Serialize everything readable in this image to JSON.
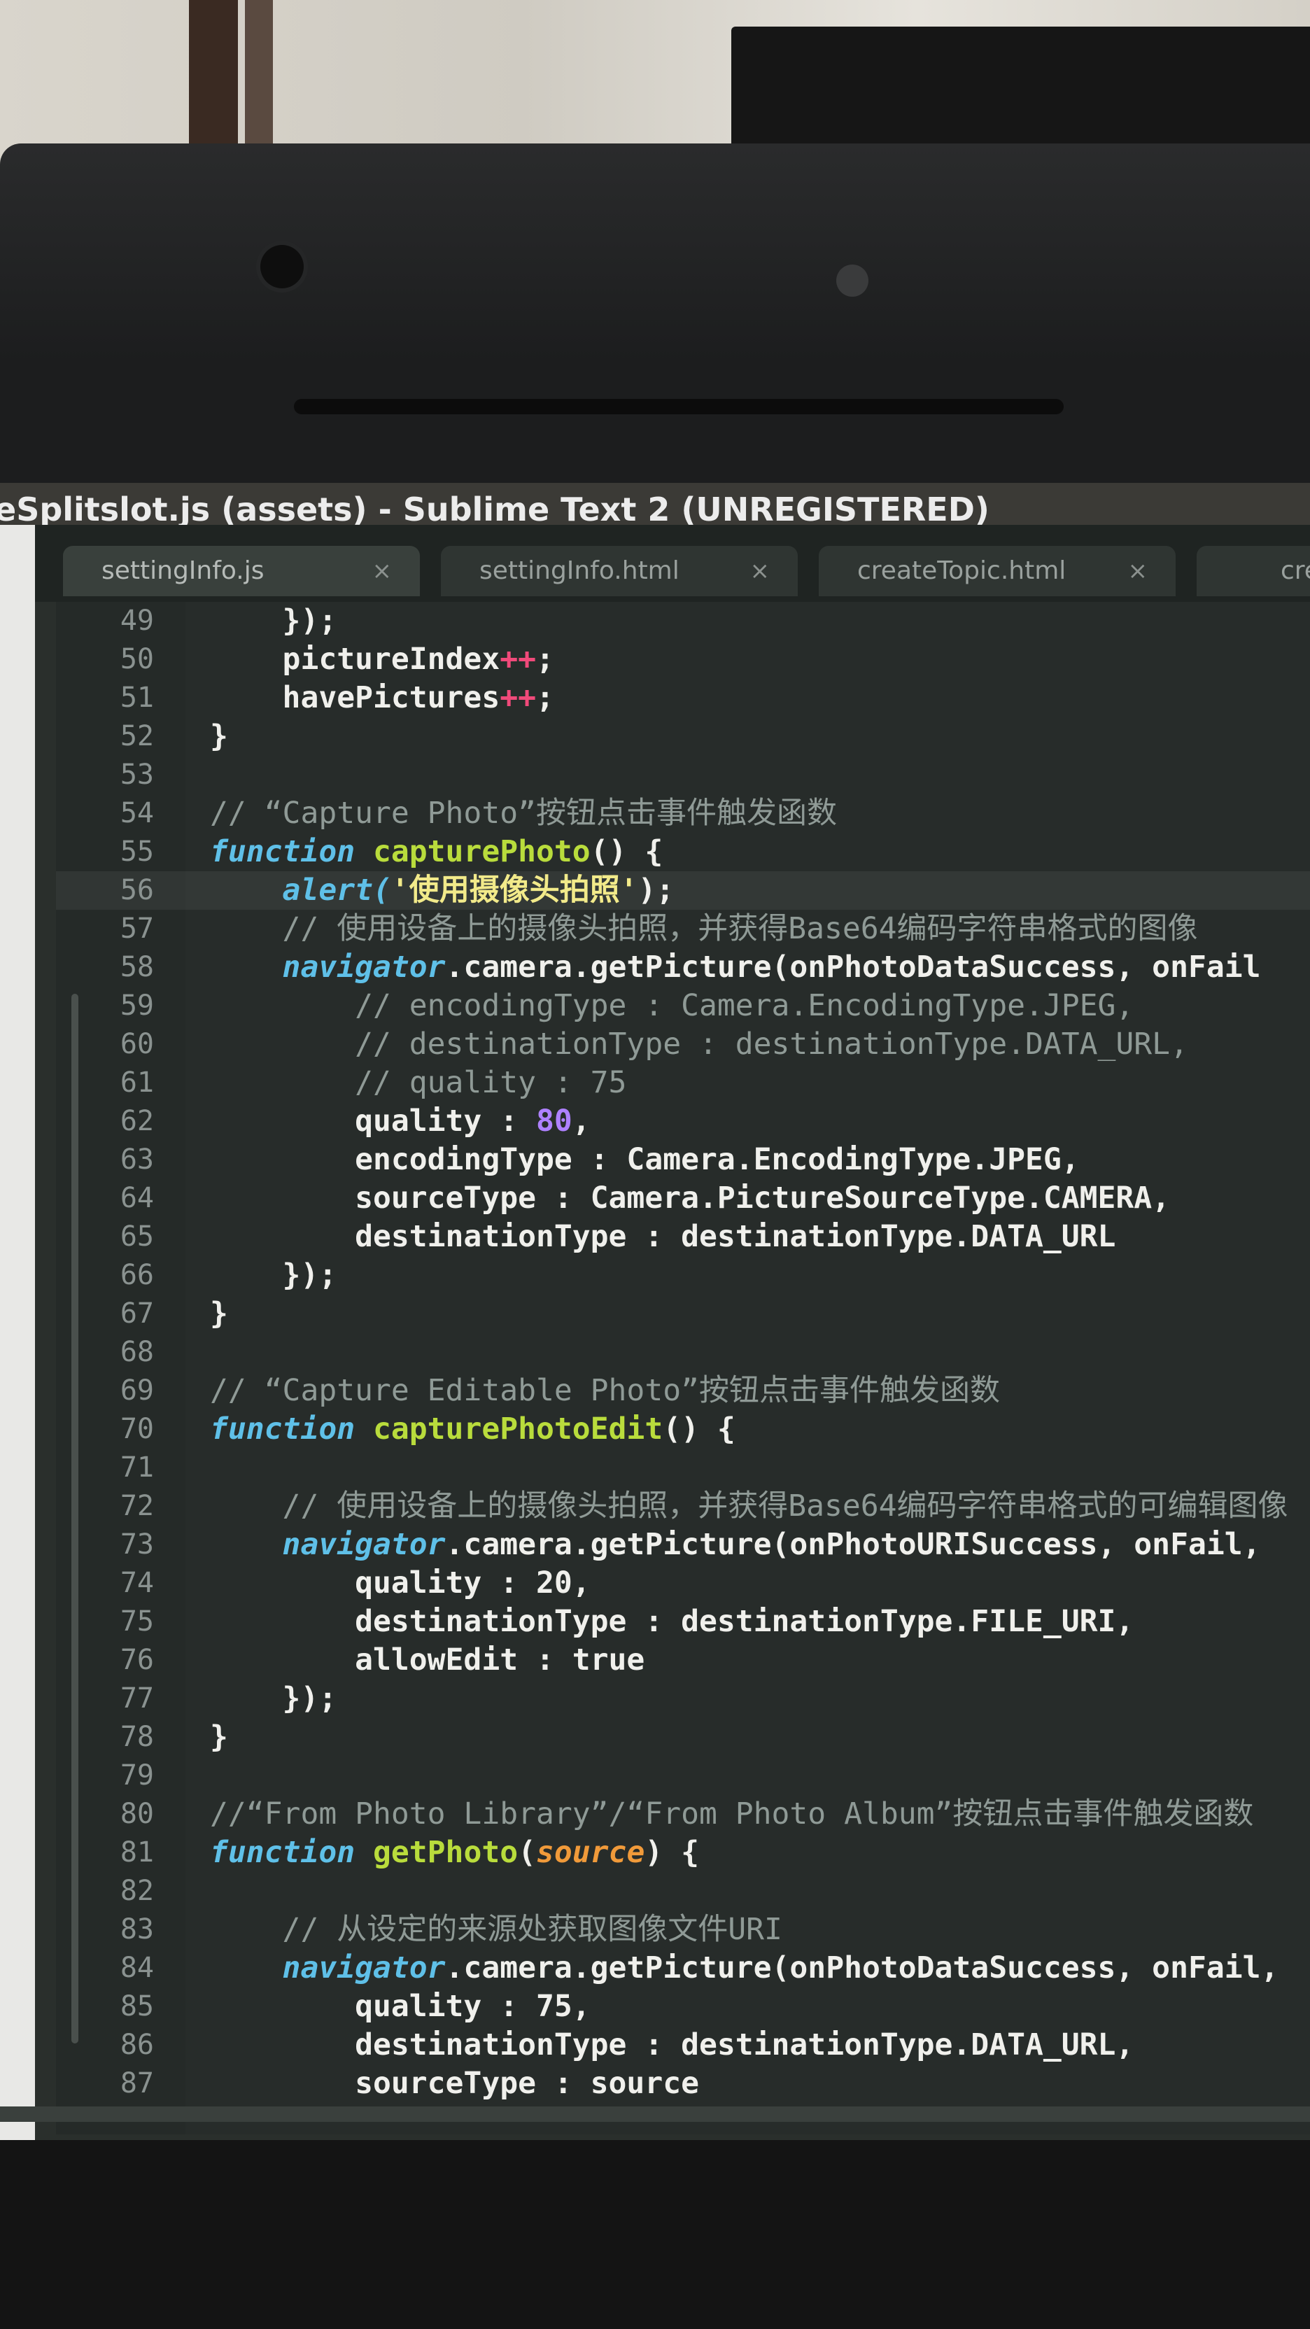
{
  "window": {
    "title": "eSplitslot.js (assets) - Sublime Text 2 (UNREGISTERED)"
  },
  "tabs": [
    {
      "label": "settingInfo.js",
      "close": "×"
    },
    {
      "label": "settingInfo.html",
      "close": "×"
    },
    {
      "label": "createTopic.html",
      "close": "×"
    },
    {
      "label": "creat",
      "close": ""
    }
  ],
  "editor": {
    "lines": [
      {
        "n": "49"
      },
      {
        "n": "50"
      },
      {
        "n": "51"
      },
      {
        "n": "52"
      },
      {
        "n": "53"
      },
      {
        "n": "54"
      },
      {
        "n": "55"
      },
      {
        "n": "56"
      },
      {
        "n": "57"
      },
      {
        "n": "58"
      },
      {
        "n": "59"
      },
      {
        "n": "60"
      },
      {
        "n": "61"
      },
      {
        "n": "62"
      },
      {
        "n": "63"
      },
      {
        "n": "64"
      },
      {
        "n": "65"
      },
      {
        "n": "66"
      },
      {
        "n": "67"
      },
      {
        "n": "68"
      },
      {
        "n": "69"
      },
      {
        "n": "70"
      },
      {
        "n": "71"
      },
      {
        "n": "72"
      },
      {
        "n": "73"
      },
      {
        "n": "74"
      },
      {
        "n": "75"
      },
      {
        "n": "76"
      },
      {
        "n": "77"
      },
      {
        "n": "78"
      },
      {
        "n": "79"
      },
      {
        "n": "80"
      },
      {
        "n": "81"
      },
      {
        "n": "82"
      },
      {
        "n": "83"
      },
      {
        "n": "84"
      },
      {
        "n": "85"
      },
      {
        "n": "86"
      },
      {
        "n": "87"
      }
    ],
    "code": {
      "l49": "    });",
      "l50a": "    pictureIndex",
      "l50b": "++",
      "l50c": ";",
      "l51a": "    havePictures",
      "l51b": "++",
      "l51c": ";",
      "l52": "}",
      "l54": "// “Capture Photo”按钮点击事件触发函数",
      "l55a": "function",
      "l55b": " capturePhoto",
      "l55c": "() {",
      "l56a": "    alert(",
      "l56b": "'使用摄像头拍照'",
      "l56c": ");",
      "l57": "    // 使用设备上的摄像头拍照，并获得Base64编码字符串格式的图像",
      "l58a": "    navigator",
      "l58b": ".camera.getPicture(onPhotoDataSuccess, onFail",
      "l59": "        // encodingType : Camera.EncodingType.JPEG,",
      "l60": "        // destinationType : destinationType.DATA_URL,",
      "l61": "        // quality : 75",
      "l62a": "        quality : ",
      "l62b": "80",
      "l62c": ",",
      "l63": "        encodingType : Camera.EncodingType.JPEG,",
      "l64": "        sourceType : Camera.PictureSourceType.CAMERA,",
      "l65": "        destinationType : destinationType.DATA_URL",
      "l66": "    });",
      "l67": "}",
      "l69": "// “Capture Editable Photo”按钮点击事件触发函数",
      "l70a": "function",
      "l70b": " capturePhotoEdit",
      "l70c": "() {",
      "l72": "    // 使用设备上的摄像头拍照，并获得Base64编码字符串格式的可编辑图像",
      "l73a": "    navigator",
      "l73b": ".camera.getPicture(onPhotoURISuccess, onFail,",
      "l74": "        quality : 20,",
      "l75": "        destinationType : destinationType.FILE_URI,",
      "l76": "        allowEdit : true",
      "l77": "    });",
      "l78": "}",
      "l80": "//“From Photo Library”/“From Photo Album”按钮点击事件触发函数",
      "l81a": "function",
      "l81b": " getPhoto",
      "l81c": "(",
      "l81d": "source",
      "l81e": ") {",
      "l83": "    // 从设定的来源处获取图像文件URI",
      "l84a": "    navigator",
      "l84b": ".camera.getPicture(onPhotoDataSuccess, onFail,",
      "l85": "        quality : 75,",
      "l86": "        destinationType : destinationType.DATA_URL,",
      "l87": "        sourceType : source"
    }
  },
  "colors": {
    "keyword": "#5fc0e8",
    "function_name": "#b9dc3c",
    "string": "#f2ea8a",
    "number": "#ae81ff",
    "operator": "#f04a7a",
    "comment": "#8f9a96"
  }
}
